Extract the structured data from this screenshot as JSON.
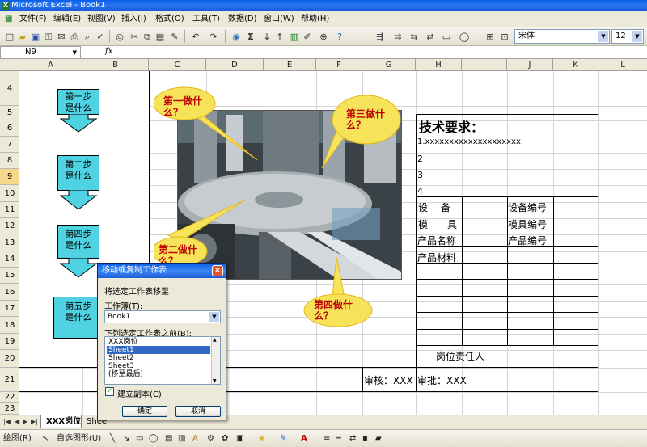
{
  "window": {
    "title": "Microsoft Excel - Book1"
  },
  "menu": [
    "文件(F)",
    "编辑(E)",
    "视图(V)",
    "插入(I)",
    "格式(O)",
    "工具(T)",
    "数据(D)",
    "窗口(W)",
    "帮助(H)"
  ],
  "toolbar": {
    "font": "宋体",
    "size": "12"
  },
  "namebox": "N9",
  "fx_label": "fx",
  "columns": [
    "A",
    "B",
    "C",
    "D",
    "E",
    "F",
    "G",
    "H",
    "I",
    "J",
    "K",
    "L"
  ],
  "rows": [
    "4",
    "5",
    "6",
    "7",
    "8",
    "9",
    "10",
    "11",
    "12",
    "13",
    "14",
    "15",
    "16",
    "17",
    "18",
    "19",
    "20",
    "21",
    "22",
    "23"
  ],
  "flow": [
    "第一步\n是什么",
    "第二步\n是什么",
    "第四步\n是什么",
    "第五步\n是什么"
  ],
  "callouts": {
    "c1": "第一做什\n么？",
    "c2": "第二做什\n么？",
    "c3": "第三做什\n么？",
    "c4": "第四做什\n么？"
  },
  "tech": {
    "title": "技术要求：",
    "items": [
      "1.xxxxxxxxxxxxxxxxxxxx.",
      "2",
      "3",
      "4"
    ],
    "equipment": "设　 备",
    "equipment_no": "设备编号",
    "mold": "模　　具",
    "mold_no": "模具编号",
    "product_name": "产品名称",
    "product_no": "产品编号",
    "product_material": "产品材料",
    "responsible": "岗位责任人",
    "review": "审核：XXX",
    "approve": "审批：XXX"
  },
  "tabs": [
    "XXX岗位",
    "Shee"
  ],
  "drawbar": {
    "draw": "绘图(R)",
    "autoshapes": "自选图形(U)"
  },
  "dialog": {
    "title": "移动或复制工作表",
    "move_label": "将选定工作表移至",
    "workbook_label": "工作簿(T):",
    "workbook_value": "Book1",
    "before_label": "下列选定工作表之前(B):",
    "sheets": [
      "XXX岗位",
      "Sheet1",
      "Sheet2",
      "Sheet3",
      "(移至最后)"
    ],
    "selected_index": 1,
    "copy_label": "建立副本(C)",
    "ok": "确定",
    "cancel": "取消"
  }
}
